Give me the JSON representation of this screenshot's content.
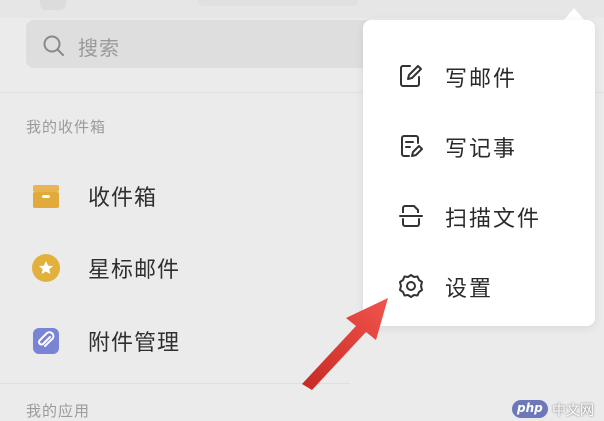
{
  "search": {
    "placeholder": "搜索"
  },
  "sections": {
    "mailboxes_title": "我的收件箱",
    "apps_title": "我的应用"
  },
  "mailbox_items": [
    {
      "label": "收件箱",
      "icon": "inbox-icon",
      "color": "#e2a93b"
    },
    {
      "label": "星标邮件",
      "icon": "star-icon",
      "color": "#e2b13c"
    },
    {
      "label": "附件管理",
      "icon": "attachment-icon",
      "color": "#7a84d6"
    }
  ],
  "menu": {
    "items": [
      {
        "label": "写邮件",
        "icon": "compose-icon"
      },
      {
        "label": "写记事",
        "icon": "note-icon"
      },
      {
        "label": "扫描文件",
        "icon": "scan-icon"
      },
      {
        "label": "设置",
        "icon": "gear-icon"
      }
    ]
  },
  "annotation": {
    "arrow_color": "#e8403a"
  },
  "watermark": {
    "brand": "php",
    "site": "中文网"
  }
}
